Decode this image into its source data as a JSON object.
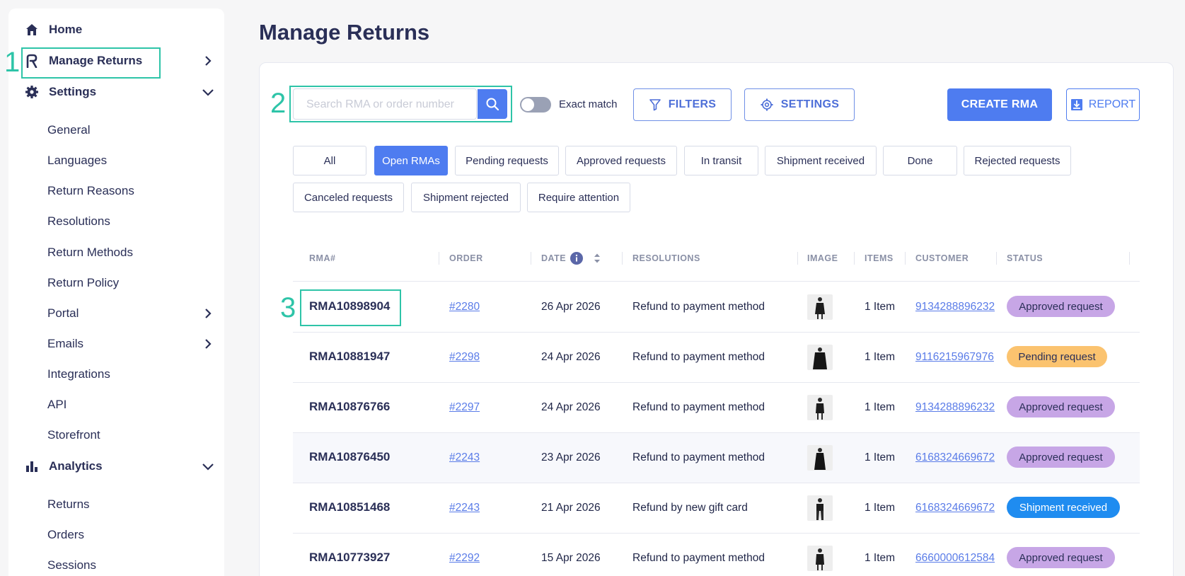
{
  "sidebar": {
    "home": "Home",
    "manage_returns": "Manage Returns",
    "settings": "Settings",
    "settings_items": [
      "General",
      "Languages",
      "Return Reasons",
      "Resolutions",
      "Return Methods",
      "Return Policy",
      "Portal",
      "Emails",
      "Integrations",
      "API",
      "Storefront"
    ],
    "analytics": "Analytics",
    "analytics_items": [
      "Returns",
      "Orders",
      "Sessions"
    ]
  },
  "annotations": [
    "1",
    "2",
    "3"
  ],
  "page_title": "Manage Returns",
  "search": {
    "placeholder": "Search RMA or order number"
  },
  "toggle": {
    "label": "Exact match",
    "on": false
  },
  "buttons": {
    "filters": "FILTERS",
    "settings": "SETTINGS",
    "create": "CREATE RMA",
    "report": "REPORT"
  },
  "chips": [
    {
      "label": "All",
      "active": false
    },
    {
      "label": "Open RMAs",
      "active": true
    },
    {
      "label": "Pending requests",
      "active": false
    },
    {
      "label": "Approved requests",
      "active": false
    },
    {
      "label": "In transit",
      "active": false
    },
    {
      "label": "Shipment received",
      "active": false
    },
    {
      "label": "Done",
      "active": false
    },
    {
      "label": "Rejected requests",
      "active": false
    },
    {
      "label": "Canceled requests",
      "active": false
    },
    {
      "label": "Shipment rejected",
      "active": false
    },
    {
      "label": "Require attention",
      "active": false
    }
  ],
  "columns": [
    "RMA#",
    "ORDER",
    "DATE",
    "RESOLUTIONS",
    "IMAGE",
    "ITEMS",
    "CUSTOMER",
    "STATUS"
  ],
  "rows": [
    {
      "rma": "RMA10898904",
      "order": "#2280",
      "date": "26 Apr 2026",
      "resolution": "Refund to payment method",
      "items": "1 Item",
      "customer": "9134288896232",
      "status": "Approved request"
    },
    {
      "rma": "RMA10881947",
      "order": "#2298",
      "date": "24 Apr 2026",
      "resolution": "Refund to payment method",
      "items": "1 Item",
      "customer": "9116215967976",
      "status": "Pending request"
    },
    {
      "rma": "RMA10876766",
      "order": "#2297",
      "date": "24 Apr 2026",
      "resolution": "Refund to payment method",
      "items": "1 Item",
      "customer": "9134288896232",
      "status": "Approved request"
    },
    {
      "rma": "RMA10876450",
      "order": "#2243",
      "date": "23 Apr 2026",
      "resolution": "Refund to payment method",
      "items": "1 Item",
      "customer": "6168324669672",
      "status": "Approved request"
    },
    {
      "rma": "RMA10851468",
      "order": "#2243",
      "date": "21 Apr 2026",
      "resolution": "Refund by new gift card",
      "items": "1 Item",
      "customer": "6168324669672",
      "status": "Shipment received"
    },
    {
      "rma": "RMA10773927",
      "order": "#2292",
      "date": "15 Apr 2026",
      "resolution": "Refund to payment method",
      "items": "1 Item",
      "customer": "6660000612584",
      "status": "Approved request"
    }
  ],
  "status_colors": {
    "Approved request": {
      "bg": "#c7a6e6",
      "fg": "#2a2f57"
    },
    "Pending request": {
      "bg": "#fbc36f",
      "fg": "#2a2f57"
    },
    "Shipment received": {
      "bg": "#1f8cf0",
      "fg": "#ffffff"
    }
  }
}
